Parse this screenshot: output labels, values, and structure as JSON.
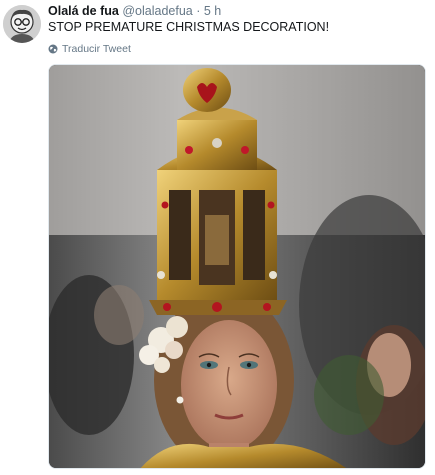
{
  "tweet": {
    "display_name": "Olalá de fua",
    "handle": "@olaladefua",
    "separator": "·",
    "timestamp": "5 h",
    "text": "STOP PREMATURE CHRISTMAS DECORATION!",
    "translate_label": "Traducir Tweet",
    "avatar_icon": "avatar-caricature-icon",
    "translate_icon": "globe-icon"
  },
  "colors": {
    "primary_text": "#14171a",
    "secondary_text": "#657786",
    "media_border": "#e1e8ed"
  }
}
